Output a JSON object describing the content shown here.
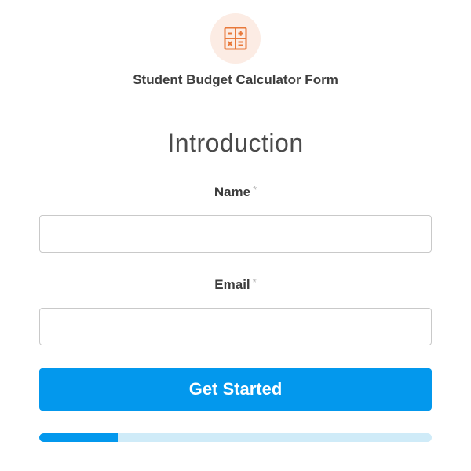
{
  "header": {
    "icon": "calculator-icon",
    "form_title": "Student Budget Calculator Form"
  },
  "section": {
    "title": "Introduction"
  },
  "fields": {
    "name": {
      "label": "Name",
      "required_mark": "*",
      "value": "",
      "placeholder": ""
    },
    "email": {
      "label": "Email",
      "required_mark": "*",
      "value": "",
      "placeholder": ""
    }
  },
  "actions": {
    "submit_label": "Get Started"
  },
  "progress": {
    "fraction": 0.2
  },
  "colors": {
    "accent": "#0398ed",
    "progress_track": "#cfebf8",
    "icon": "#e8793a",
    "icon_bg": "#fcece4"
  }
}
